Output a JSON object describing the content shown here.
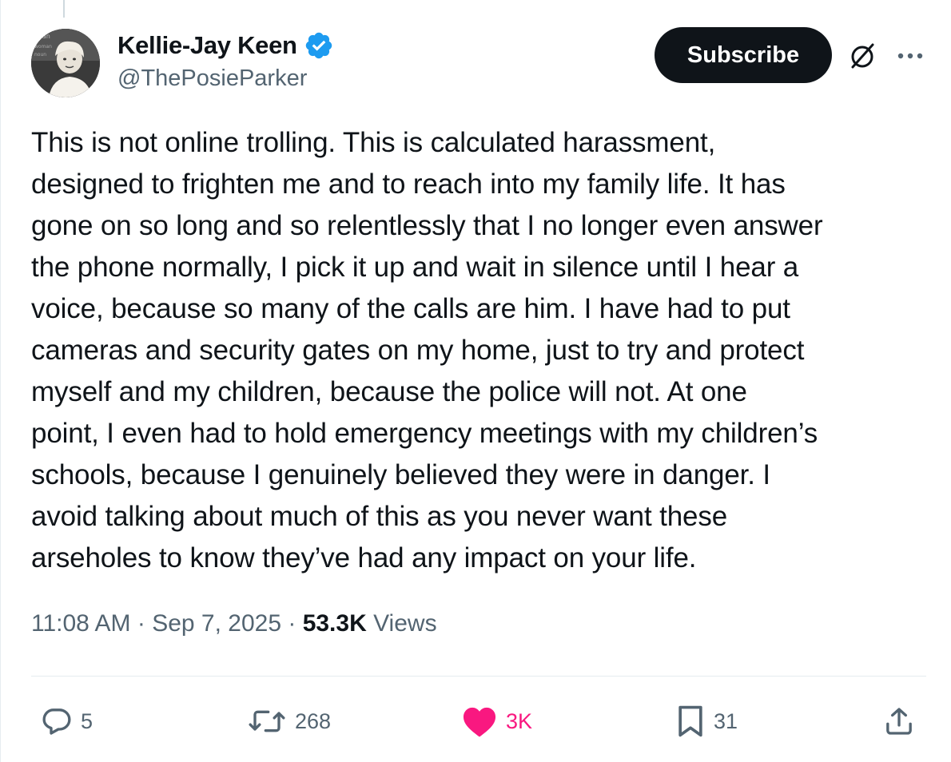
{
  "author": {
    "display_name": "Kellie-Jay Keen",
    "handle": "@ThePosieParker",
    "verified": true,
    "avatar_icon": "profile-photo"
  },
  "header": {
    "subscribe_label": "Subscribe",
    "icons": [
      "grok-icon",
      "more-icon"
    ]
  },
  "tweet": {
    "text": "This is not online trolling. This is calculated harassment,\ndesigned to frighten me and to reach into my family life. It has\ngone on so long and so relentlessly that I no longer even answer\nthe phone normally, I pick it up and wait in silence until I hear a\nvoice, because so many of the calls are him. I have had to put\ncameras and security gates on my home, just to try and protect\nmyself and my children, because the police will not. At one\npoint, I even had to hold emergency meetings with my children’s\nschools, because I genuinely believed they were in danger. I\navoid talking about much of this as you never want these\narseholes to know they’ve had any impact on your life."
  },
  "meta": {
    "time": "11:08 AM",
    "separator": " · ",
    "date": "Sep 7, 2025",
    "views_count": "53.3K",
    "views_label": " Views"
  },
  "actions": {
    "replies": "5",
    "reposts": "268",
    "likes": "3K",
    "bookmarks": "31"
  },
  "colors": {
    "text": "#0f1419",
    "secondary": "#536471",
    "verified_blue": "#1d9bf0",
    "like_pink": "#f91880",
    "button_dark": "#0f1419"
  }
}
